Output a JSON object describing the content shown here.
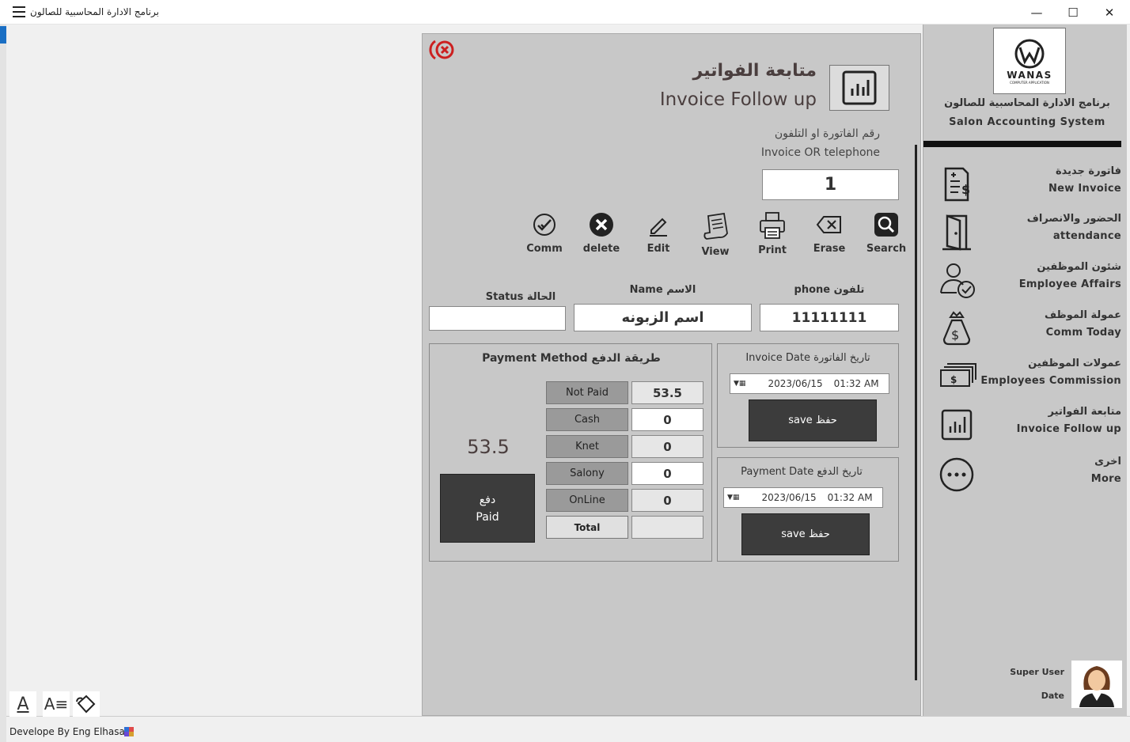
{
  "window": {
    "title": "برنامج الادارة المحاسبية للصالون",
    "minimize": "—",
    "maximize": "☐",
    "close": "✕"
  },
  "header": {
    "title_ar": "متابعة الفواتير",
    "title_en": "Invoice Follow up"
  },
  "search": {
    "label_ar": "رقم الفاتورة او التلفون",
    "label_en": "Invoice OR telephone",
    "value": "1"
  },
  "toolbar": {
    "comm": "Comm",
    "delete": "delete",
    "edit": "Edit",
    "view": "View",
    "print": "Print",
    "erase": "Erase",
    "search": "Search"
  },
  "customer": {
    "phone_label": "phone تلفون",
    "phone_value": "11111111",
    "name_label": "Name الاسم",
    "name_value": "اسم الزبونه",
    "status_label": "Status الحالة",
    "status_value": ""
  },
  "payment": {
    "title": "Payment Method طريقة الدفع",
    "amount": "53.5",
    "paid_ar": "دفع",
    "paid_en": "Paid",
    "rows": [
      {
        "label": "Not Paid",
        "value": "53.5"
      },
      {
        "label": "Cash",
        "value": "0"
      },
      {
        "label": "Knet",
        "value": "0"
      },
      {
        "label": "Salony",
        "value": "0"
      },
      {
        "label": "OnLine",
        "value": "0"
      },
      {
        "label": "Total",
        "value": ""
      }
    ]
  },
  "invoice_date": {
    "title": "Invoice Date تاريخ الفاتورة",
    "date": "2023/06/15",
    "time": "01:32 AM",
    "save": "save حفظ"
  },
  "payment_date": {
    "title": "Payment Date تاريخ الدفع",
    "date": "2023/06/15",
    "time": "01:32 AM",
    "save": "save حفظ"
  },
  "sidebar": {
    "logo_text": "WANAS",
    "logo_sub": "COMPUTER APPLICATION",
    "app_ar": "برنامج الادارة المحاسبية للصالون",
    "app_en": "Salon Accounting System",
    "items": [
      {
        "ar": "فاتورة جديدة",
        "en": "New Invoice",
        "icon": "invoice-icon"
      },
      {
        "ar": "الحضور والانصراف",
        "en": "attendance",
        "icon": "door-icon"
      },
      {
        "ar": "شئون الموظفين",
        "en": "Employee Affairs",
        "icon": "employee-icon"
      },
      {
        "ar": "عمولة الموظف",
        "en": "Comm Today",
        "icon": "money-bag-icon"
      },
      {
        "ar": "عمولات الموظفين",
        "en": "Employees Commission",
        "icon": "cash-stack-icon"
      },
      {
        "ar": "متابعة الفواتير",
        "en": "Invoice Follow up",
        "icon": "chart-icon"
      },
      {
        "ar": "اخرى",
        "en": "More",
        "icon": "more-icon"
      }
    ],
    "user_label": "Super User",
    "date_label": "Date"
  },
  "footer": {
    "credit": "Develope By Eng Elhasan"
  },
  "colors": {
    "panel": "#c8c8c8",
    "dark_button": "#3c3c3c",
    "close_red": "#cc1f1f"
  }
}
